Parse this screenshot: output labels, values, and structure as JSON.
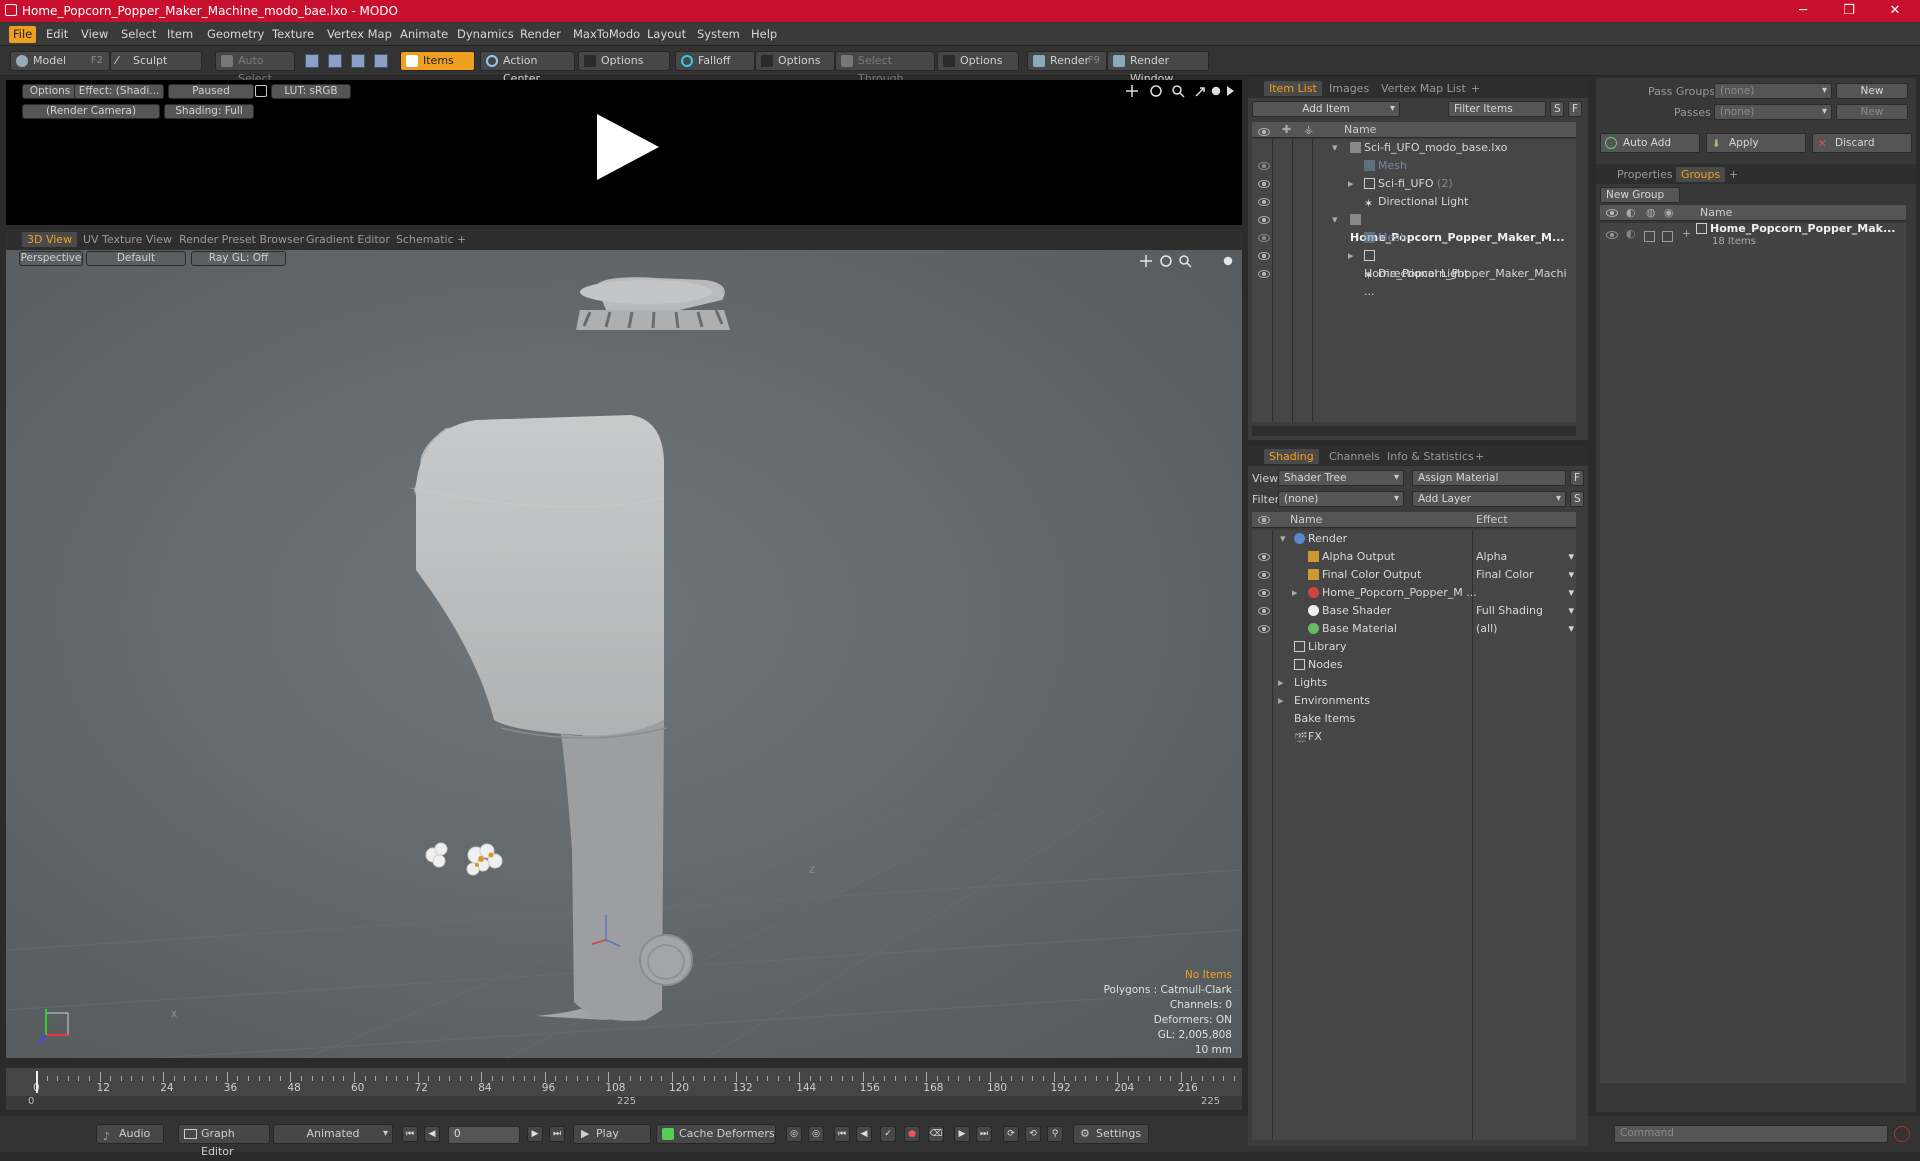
{
  "window": {
    "title": "Home_Popcorn_Popper_Maker_Machine_modo_bae.lxo - MODO",
    "minimize": "─",
    "maximize": "❐",
    "close": "✕"
  },
  "menu": [
    "File",
    "Edit",
    "View",
    "Select",
    "Item",
    "Geometry",
    "Texture",
    "Vertex Map",
    "Animate",
    "Dynamics",
    "Render",
    "MaxToModo",
    "Layout",
    "System",
    "Help"
  ],
  "toolbar": {
    "model": "Model",
    "model_key": "F2",
    "sculpt": "Sculpt",
    "auto_select": "Auto Select",
    "items": "Items",
    "action_center": "Action Center",
    "options1": "Options",
    "falloff": "Falloff",
    "options2": "Options",
    "select_through": "Select Through",
    "options3": "Options",
    "render": "Render",
    "render_key": "F9",
    "render_window": "Render Window"
  },
  "preview": {
    "options": "Options",
    "effect": "Effect: (Shadi...",
    "paused": "Paused",
    "lut": "LUT: sRGB",
    "camera": "(Render Camera)",
    "shading": "Shading: Full"
  },
  "viewport_tabs": [
    "3D View",
    "UV Texture View",
    "Render Preset Browser",
    "Gradient Editor",
    "Schematic",
    "+"
  ],
  "viewport": {
    "perspective": "Perspective",
    "default": "Default",
    "raygl": "Ray GL: Off",
    "info": {
      "no_items": "No Items",
      "polygons": "Polygons : Catmull-Clark",
      "channels": "Channels: 0",
      "deformers": "Deformers: ON",
      "gl": "GL: 2,005,808",
      "scale": "10 mm"
    },
    "axis_x": "X",
    "axis_z": "Z"
  },
  "timeline": {
    "ticks": [
      "0",
      "12",
      "24",
      "36",
      "48",
      "60",
      "72",
      "84",
      "96",
      "108",
      "120",
      "132",
      "144",
      "156",
      "168",
      "180",
      "192",
      "204",
      "216"
    ],
    "range_start": "0",
    "range_mid": "225",
    "range_end": "225"
  },
  "bottombar": {
    "audio": "Audio",
    "graph_editor": "Graph Editor",
    "animated": "Animated",
    "frame": "0",
    "play": "Play",
    "cache_deformers": "Cache Deformers",
    "settings": "Settings"
  },
  "item_list": {
    "tabs": [
      "Item List",
      "Images",
      "Vertex Map List",
      "+"
    ],
    "add_item": "Add Item",
    "filter_items": "Filter Items",
    "s": "S",
    "f": "F",
    "col_name": "Name",
    "rows": [
      {
        "label": "Sci-fi_UFO_modo_base.lxo",
        "bold": false
      },
      {
        "label": "Mesh",
        "dim": true
      },
      {
        "label": "Sci-fi_UFO",
        "count": "(2)"
      },
      {
        "label": "Directional Light"
      },
      {
        "label": "Home_Popcorn_Popper_Maker_M...",
        "bold": true
      },
      {
        "label": "Mesh",
        "dim": true
      },
      {
        "label": "Home_Popcorn_Popper_Maker_Machi ..."
      },
      {
        "label": "Directional Light"
      }
    ]
  },
  "shading": {
    "tabs": [
      "Shading",
      "Channels",
      "Info & Statistics",
      "+"
    ],
    "view_label": "View",
    "view_value": "Shader Tree",
    "assign_material": "Assign Material",
    "f": "F",
    "filter_label": "Filter",
    "filter_value": "(none)",
    "add_layer": "Add Layer",
    "s": "S",
    "col_name": "Name",
    "col_effect": "Effect",
    "rows": [
      {
        "label": "Render",
        "effect": ""
      },
      {
        "label": "Alpha Output",
        "effect": "Alpha"
      },
      {
        "label": "Final Color Output",
        "effect": "Final Color"
      },
      {
        "label": "Home_Popcorn_Popper_M ...",
        "effect": ""
      },
      {
        "label": "Base Shader",
        "effect": "Full Shading"
      },
      {
        "label": "Base Material",
        "effect": "(all)"
      },
      {
        "label": "Library",
        "effect": ""
      },
      {
        "label": "Nodes",
        "effect": ""
      },
      {
        "label": "Lights",
        "effect": ""
      },
      {
        "label": "Environments",
        "effect": ""
      },
      {
        "label": "Bake Items",
        "effect": ""
      },
      {
        "label": "FX",
        "effect": ""
      }
    ]
  },
  "groups": {
    "pass_groups_label": "Pass Groups",
    "pass_groups_value": "(none)",
    "new": "New",
    "passes_label": "Passes",
    "passes_value": "(none)",
    "new2": "New",
    "auto_add": "Auto Add",
    "apply": "Apply",
    "discard": "Discard",
    "tabs": [
      "Properties",
      "Groups",
      "+"
    ],
    "new_group": "New Group",
    "col_name": "Name",
    "group_name": "Home_Popcorn_Popper_Mak...",
    "group_count": "18 Items"
  },
  "command": {
    "placeholder": "Command"
  },
  "colors": {
    "accent": "#f0a020",
    "titlebar": "#c8102e"
  }
}
